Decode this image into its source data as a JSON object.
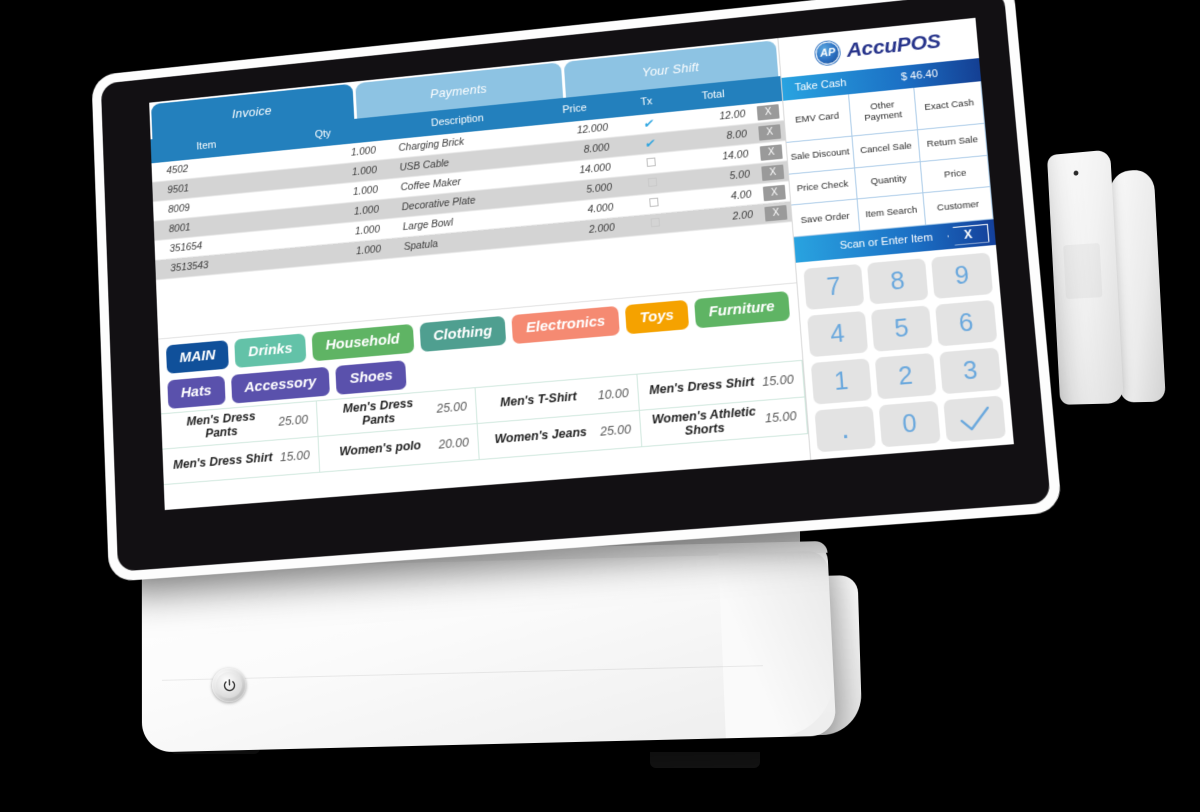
{
  "brand": {
    "logo_mark": "AP",
    "name": "AccuPOS"
  },
  "tabs": [
    {
      "label": "Invoice",
      "active": true
    },
    {
      "label": "Payments",
      "active": false
    },
    {
      "label": "Your Shift",
      "active": false
    }
  ],
  "invoice": {
    "columns": [
      "Item",
      "Qty",
      "Description",
      "Price",
      "Tx",
      "Total"
    ],
    "delete_label": "X",
    "rows": [
      {
        "item": "4502",
        "qty": "1.000",
        "description": "Charging Brick",
        "price": "12.000",
        "taxed": true,
        "total": "12.00"
      },
      {
        "item": "9501",
        "qty": "1.000",
        "description": "USB Cable",
        "price": "8.000",
        "taxed": true,
        "total": "8.00"
      },
      {
        "item": "8009",
        "qty": "1.000",
        "description": "Coffee Maker",
        "price": "14.000",
        "taxed": false,
        "total": "14.00"
      },
      {
        "item": "8001",
        "qty": "1.000",
        "description": "Decorative Plate",
        "price": "5.000",
        "taxed": false,
        "total": "5.00"
      },
      {
        "item": "351654",
        "qty": "1.000",
        "description": "Large Bowl",
        "price": "4.000",
        "taxed": false,
        "total": "4.00"
      },
      {
        "item": "3513543",
        "qty": "1.000",
        "description": "Spatula",
        "price": "2.000",
        "taxed": false,
        "total": "2.00"
      }
    ]
  },
  "departments": [
    {
      "label": "MAIN",
      "color": "#10509a",
      "active": true
    },
    {
      "label": "Drinks",
      "color": "#63c2a8",
      "active": false
    },
    {
      "label": "Household",
      "color": "#5fb464",
      "active": false
    },
    {
      "label": "Clothing",
      "color": "#4f9f90",
      "active": false
    },
    {
      "label": "Electronics",
      "color": "#f58a72",
      "active": false
    },
    {
      "label": "Toys",
      "color": "#f5a200",
      "active": false
    },
    {
      "label": "Furniture",
      "color": "#5fb464",
      "active": false
    },
    {
      "label": "Hats",
      "color": "#5a51ac",
      "active": false
    },
    {
      "label": "Accessory",
      "color": "#5a51ac",
      "active": false
    },
    {
      "label": "Shoes",
      "color": "#5a51ac",
      "active": false
    }
  ],
  "products": [
    {
      "name": "Men's Dress Pants",
      "price": "25.00"
    },
    {
      "name": "Men's Dress Pants",
      "price": "25.00"
    },
    {
      "name": "Men's T-Shirt",
      "price": "10.00"
    },
    {
      "name": "Men's Dress Shirt",
      "price": "15.00"
    },
    {
      "name": "Men's Dress Shirt",
      "price": "15.00"
    },
    {
      "name": "Women's polo",
      "price": "20.00"
    },
    {
      "name": "Women's Jeans",
      "price": "25.00"
    },
    {
      "name": "Women's Athletic Shorts",
      "price": "15.00"
    }
  ],
  "take_cash": {
    "label": "Take Cash",
    "amount": "$ 46.40"
  },
  "function_buttons": [
    "EMV Card",
    "Other Payment",
    "Exact Cash",
    "Sale Discount",
    "Cancel Sale",
    "Return Sale",
    "Price Check",
    "Quantity",
    "Price",
    "Save Order",
    "Item Search",
    "Customer"
  ],
  "scan": {
    "label": "Scan or Enter Item",
    "backspace_label": "X"
  },
  "keypad": [
    {
      "label": "7",
      "type": "digit"
    },
    {
      "label": "8",
      "type": "digit"
    },
    {
      "label": "9",
      "type": "digit"
    },
    {
      "label": "4",
      "type": "digit"
    },
    {
      "label": "5",
      "type": "digit"
    },
    {
      "label": "6",
      "type": "digit"
    },
    {
      "label": "1",
      "type": "digit"
    },
    {
      "label": "2",
      "type": "digit"
    },
    {
      "label": "3",
      "type": "digit"
    },
    {
      "label": ".",
      "type": "decimal"
    },
    {
      "label": "0",
      "type": "digit"
    },
    {
      "label": "",
      "type": "enter"
    }
  ],
  "hardware": {
    "power_button": "power-button",
    "card_reader": "card-reader"
  },
  "colors": {
    "accent_blue": "#2380bd",
    "tab_inactive": "#8dc3e3",
    "bar_gradient_start": "#29a3e0",
    "bar_gradient_end": "#14409a",
    "key_face": "#e3e3e3",
    "key_text": "#6aa8dd",
    "brand_navy": "#27348b"
  }
}
